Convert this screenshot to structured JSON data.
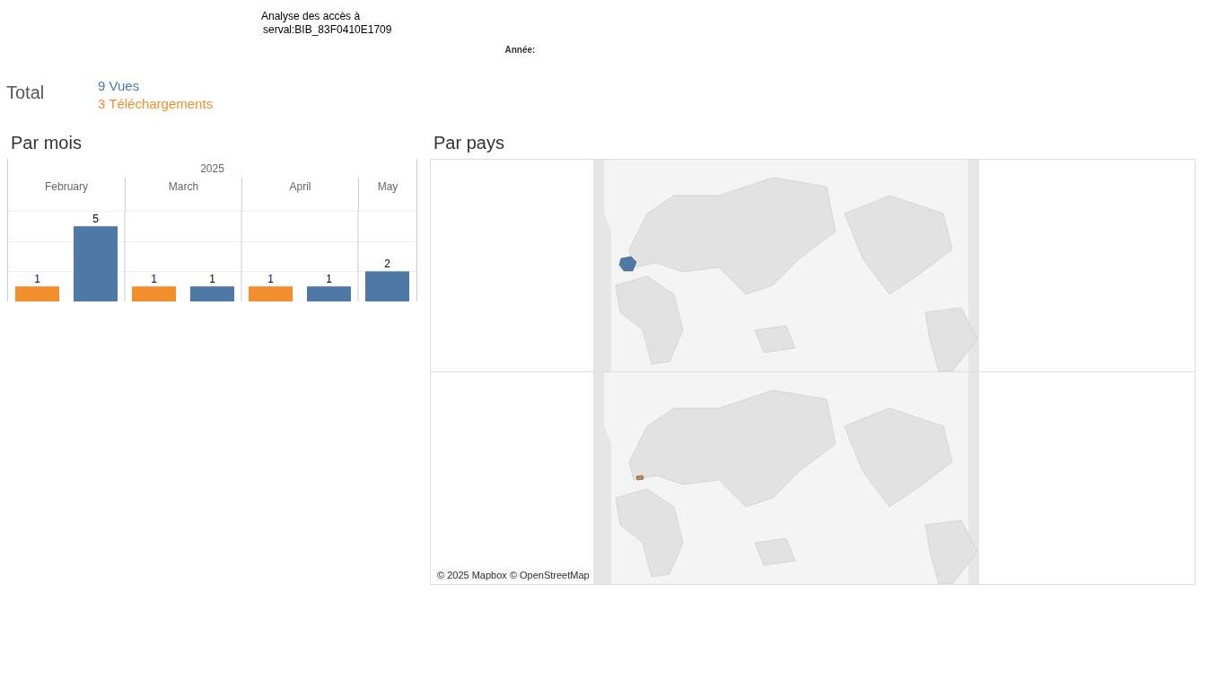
{
  "header": {
    "title": "Analyse des accès à",
    "subtitle": "serval:BIB_83F0410E1709",
    "filter_label": "Année:"
  },
  "totals": {
    "label": "Total",
    "items": [
      {
        "text": "9 Vues",
        "color": "#4e79a7"
      },
      {
        "text": "3 Téléchargements",
        "color": "#f28e2b"
      }
    ]
  },
  "by_month": {
    "title": "Par mois",
    "year": "2025",
    "chart_data": {
      "type": "bar",
      "categories": [
        "February",
        "March",
        "April",
        "May"
      ],
      "data_labels": true,
      "series": [
        {
          "color": "#f28e2b",
          "values": [
            1,
            1,
            1,
            null
          ]
        },
        {
          "color": "#4e79a7",
          "values": [
            5,
            1,
            1,
            2
          ]
        }
      ]
    }
  },
  "by_country": {
    "title": "Par pays",
    "attribution": "© 2025 Mapbox © OpenStreetMap"
  }
}
